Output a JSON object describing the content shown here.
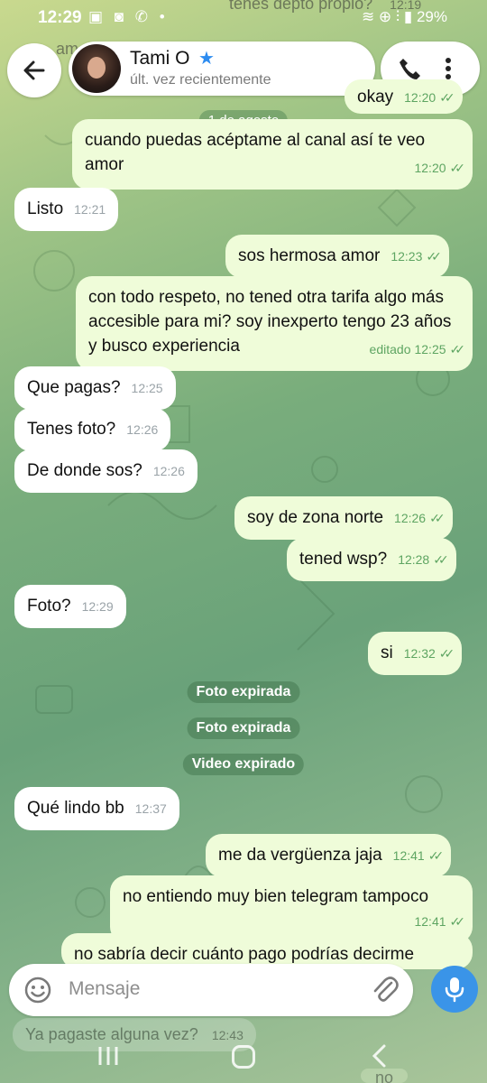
{
  "status_bar": {
    "time": "12:29",
    "left_icons": "▣ ◙ ✆ •",
    "right_icons": "≋ ⊕ ⫶ ▮",
    "battery": "29%"
  },
  "header": {
    "back_label": "←",
    "contact_name": "Tami O",
    "star": "★",
    "last_seen": "últ. vez recientemente"
  },
  "partial_top": {
    "out_text": "tenes depto propio?",
    "out_time": "12:19",
    "in_text": "am"
  },
  "date_chip": "1 de agosto",
  "messages": [
    {
      "dir": "out",
      "text": "okay",
      "time": "12:20",
      "ticks": "✓✓"
    },
    {
      "dir": "out",
      "text": "cuando puedas acéptame al canal así te veo amor",
      "time": "12:20",
      "ticks": "✓✓"
    },
    {
      "dir": "in",
      "text": "Listo",
      "time": "12:21"
    },
    {
      "dir": "out",
      "text": "sos hermosa amor",
      "time": "12:23",
      "ticks": "✓✓"
    },
    {
      "dir": "out",
      "text": "con todo respeto, no tened otra tarifa algo más accesible para mi? soy inexperto tengo 23 años y busco experiencia",
      "time": "12:25",
      "edited": "editado",
      "ticks": "✓✓"
    },
    {
      "dir": "in",
      "text": "Que pagas?",
      "time": "12:25"
    },
    {
      "dir": "in",
      "text": "Tenes foto?",
      "time": "12:26"
    },
    {
      "dir": "in",
      "text": "De donde sos?",
      "time": "12:26"
    },
    {
      "dir": "out",
      "text": "soy de zona norte",
      "time": "12:26",
      "ticks": "✓✓"
    },
    {
      "dir": "out",
      "text": "tened wsp?",
      "time": "12:28",
      "ticks": "✓✓"
    },
    {
      "dir": "in",
      "text": "Foto?",
      "time": "12:29"
    },
    {
      "dir": "out",
      "text": "si",
      "time": "12:32",
      "ticks": "✓✓"
    },
    {
      "dir": "in",
      "text": "Qué lindo bb",
      "time": "12:37"
    },
    {
      "dir": "out",
      "text": "me da vergüenza jaja",
      "time": "12:41",
      "ticks": "✓✓"
    },
    {
      "dir": "out",
      "text": "no entiendo muy bien telegram tampoco",
      "time": "12:41",
      "ticks": "✓✓"
    },
    {
      "dir": "out",
      "text": "no sabría decir cuánto pago podrías decirme"
    }
  ],
  "system_chips": [
    "Foto expirada",
    "Foto expirada",
    "Video expirado"
  ],
  "partial_bottom": {
    "in_text": "Ya pagaste alguna vez?",
    "in_time": "12:43",
    "out_text": "no"
  },
  "input": {
    "placeholder": "Mensaje"
  },
  "colors": {
    "incoming_bubble": "#ffffff",
    "outgoing_bubble": "#effcd9",
    "accent": "#3a94e8",
    "tick": "#5ea562"
  }
}
